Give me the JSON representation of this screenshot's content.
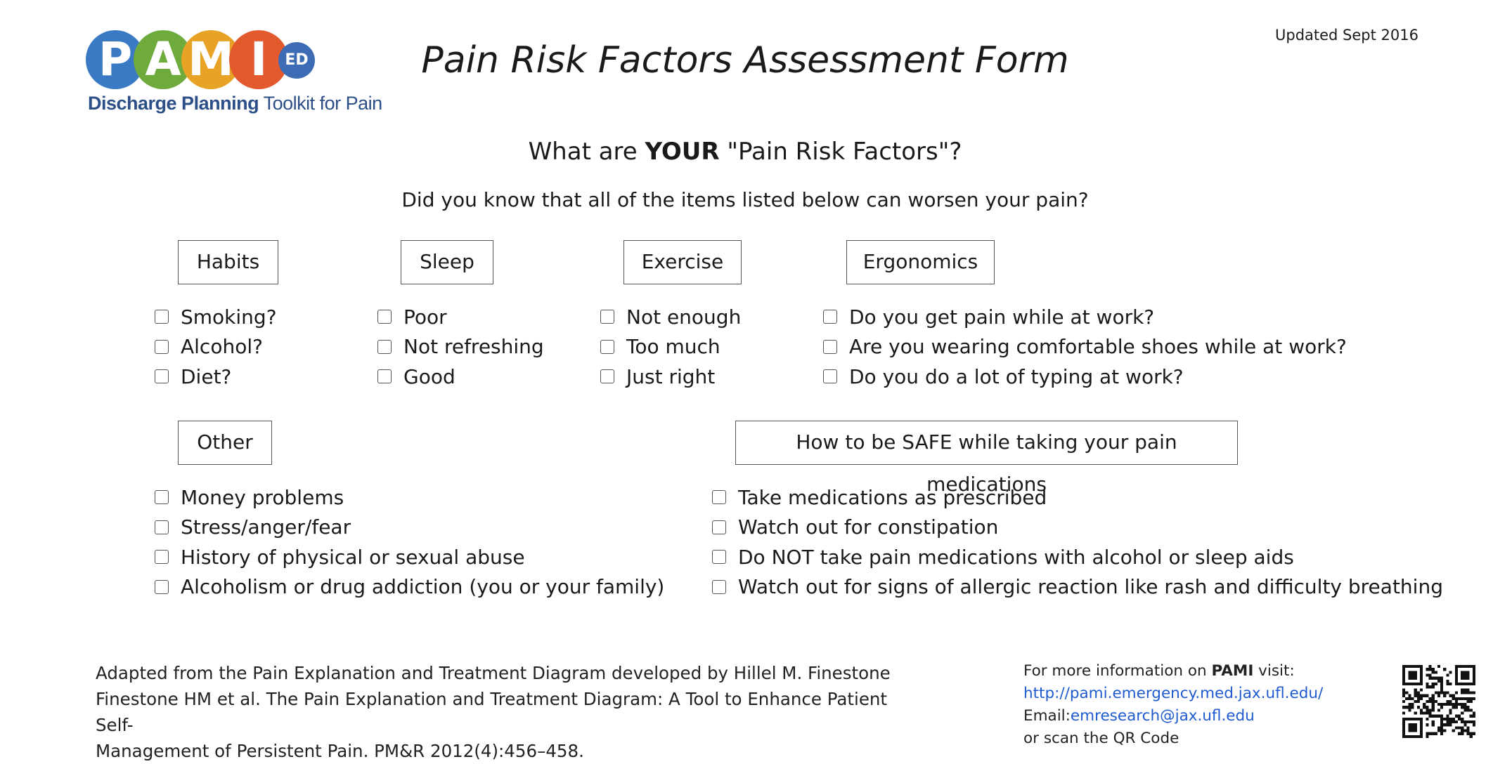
{
  "logo": {
    "letters": [
      "P",
      "A",
      "M",
      "I"
    ],
    "badge": "ED",
    "tagline_bold": "Discharge Planning",
    "tagline_rest": " Toolkit for Pain",
    "colors": [
      "#3a79c3",
      "#6eab3c",
      "#e8a327",
      "#e35a2f"
    ]
  },
  "header": {
    "title": "Pain Risk Factors Assessment Form",
    "updated": "Updated Sept 2016"
  },
  "intro": {
    "question_pre": "What are ",
    "question_bold": "YOUR",
    "question_post": " \"Pain Risk Factors\"?",
    "subquestion": "Did you know that all of the items listed below can worsen your pain?"
  },
  "categories": {
    "habits": {
      "label": "Habits",
      "items": [
        "Smoking?",
        "Alcohol?",
        "Diet?"
      ]
    },
    "sleep": {
      "label": "Sleep",
      "items": [
        "Poor",
        "Not refreshing",
        "Good"
      ]
    },
    "exercise": {
      "label": "Exercise",
      "items": [
        "Not enough",
        "Too much",
        "Just right"
      ]
    },
    "ergonomics": {
      "label": "Ergonomics",
      "items": [
        "Do you get pain while at work?",
        "Are you wearing comfortable shoes while at work?",
        "Do you do a lot of typing at work?"
      ]
    },
    "other": {
      "label": "Other",
      "items": [
        "Money problems",
        "Stress/anger/fear",
        "History of physical or sexual abuse",
        "Alcoholism or drug addiction (you or your family)"
      ]
    },
    "safe": {
      "label": "How to be SAFE while taking your pain medications",
      "items": [
        "Take medications as prescribed",
        "Watch out for constipation",
        "Do NOT take pain medications with alcohol or sleep aids",
        "Watch out for signs of allergic reaction like rash and difficulty breathing"
      ]
    }
  },
  "footer": {
    "adapted_lines": [
      "Adapted from the Pain Explanation and Treatment Diagram developed by Hillel M. Finestone",
      "Finestone HM et al. The Pain Explanation and Treatment Diagram: A Tool to Enhance Patient Self-",
      "Management of Persistent Pain. PM&R 2012(4):456–458."
    ],
    "more_pre": "For more information on ",
    "more_bold": "PAMI",
    "more_post": " visit:",
    "url": "http://pami.emergency.med.jax.ufl.edu/",
    "email_label": "Email:",
    "email": "emresearch@jax.ufl.edu",
    "scan": "or scan the QR Code"
  }
}
